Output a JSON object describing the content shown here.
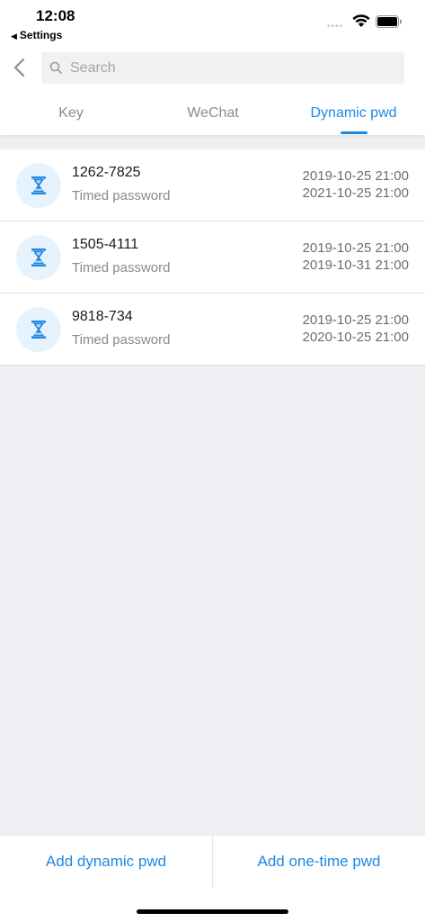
{
  "status_bar": {
    "time": "12:08",
    "back_app": "Settings",
    "back_triangle": "◀",
    "signal": "••••"
  },
  "search": {
    "placeholder": "Search",
    "value": ""
  },
  "tabs": [
    {
      "label": "Key",
      "active": false
    },
    {
      "label": "WeChat",
      "active": false
    },
    {
      "label": "Dynamic pwd",
      "active": true
    }
  ],
  "passwords": [
    {
      "code": "1262-7825",
      "type": "Timed password",
      "start": "2019-10-25 21:00",
      "end": "2021-10-25 21:00"
    },
    {
      "code": "1505-4111",
      "type": "Timed password",
      "start": "2019-10-25 21:00",
      "end": "2019-10-31 21:00"
    },
    {
      "code": "9818-734",
      "type": "Timed password",
      "start": "2019-10-25 21:00",
      "end": "2020-10-25 21:00"
    }
  ],
  "bottom": {
    "add_dynamic": "Add dynamic pwd",
    "add_one_time": "Add one-time pwd"
  },
  "colors": {
    "accent": "#1e88e5",
    "background": "#efeff4",
    "icon_bg": "#e6f3fd"
  },
  "icons": {
    "row_icon": "hourglass-icon",
    "back": "chevron-left-icon",
    "search": "search-icon"
  }
}
